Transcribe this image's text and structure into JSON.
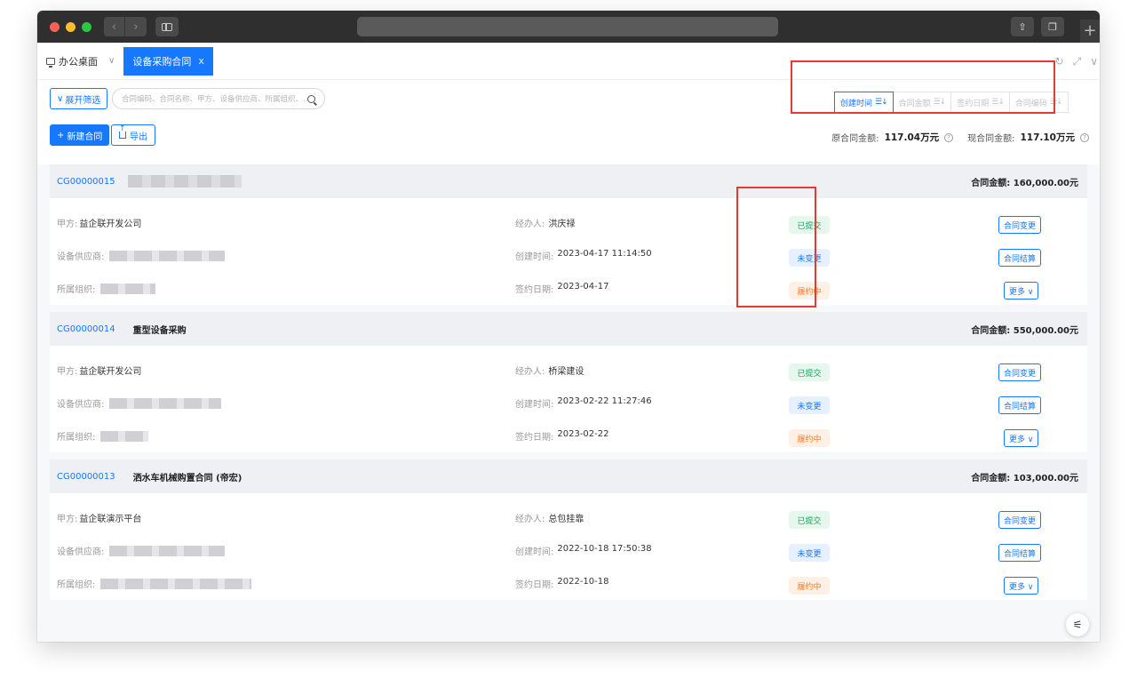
{
  "tabs": {
    "home": "办公桌面",
    "active": "设备采购合同",
    "close": "x"
  },
  "toolbar": {
    "filter_label": "展开筛选",
    "search_placeholder": "合同编码、合同名称、甲方、设备供应商、所属组织、...",
    "sort_buttons": [
      "创建时间",
      "合同金额",
      "签约日期",
      "合同编码"
    ],
    "new_label": "新建合同",
    "export_label": "导出",
    "original_total_label": "原合同金额:",
    "original_total": "117.04万元",
    "current_total_label": "现合同金额:",
    "current_total": "117.10万元"
  },
  "labels": {
    "party_a": "甲方:",
    "supplier": "设备供应商:",
    "org": "所属组织:",
    "handler": "经办人:",
    "created": "创建时间:",
    "signed": "签约日期:",
    "amount": "合同金额:",
    "change": "合同变更",
    "settle": "合同结算",
    "more": "更多 ∨"
  },
  "contracts": [
    {
      "code": "CG00000015",
      "name": "",
      "amount": "160,000.00元",
      "party_a": "益企联开发公司",
      "handler": "洪庆禄",
      "created": "2023-04-17 11:14:50",
      "signed": "2023-04-17",
      "status1": "已提交",
      "status2": "未变更",
      "status3": "履约中"
    },
    {
      "code": "CG00000014",
      "name": "重型设备采购",
      "amount": "550,000.00元",
      "party_a": "益企联开发公司",
      "handler": "桥梁建设",
      "created": "2023-02-22 11:27:46",
      "signed": "2023-02-22",
      "status1": "已提交",
      "status2": "未变更",
      "status3": "履约中"
    },
    {
      "code": "CG00000013",
      "name": "洒水车机械购置合同 (帝宏)",
      "amount": "103,000.00元",
      "party_a": "益企联演示平台",
      "handler": "总包挂靠",
      "created": "2022-10-18 17:50:38",
      "signed": "2022-10-18",
      "status1": "已提交",
      "status2": "未变更",
      "status3": "履约中"
    }
  ],
  "colors": {
    "primary": "#1677ff",
    "submitted": "#1aa35c",
    "unchanged": "#1677ff",
    "performing": "#f07a2a",
    "highlight": "#e53935"
  }
}
